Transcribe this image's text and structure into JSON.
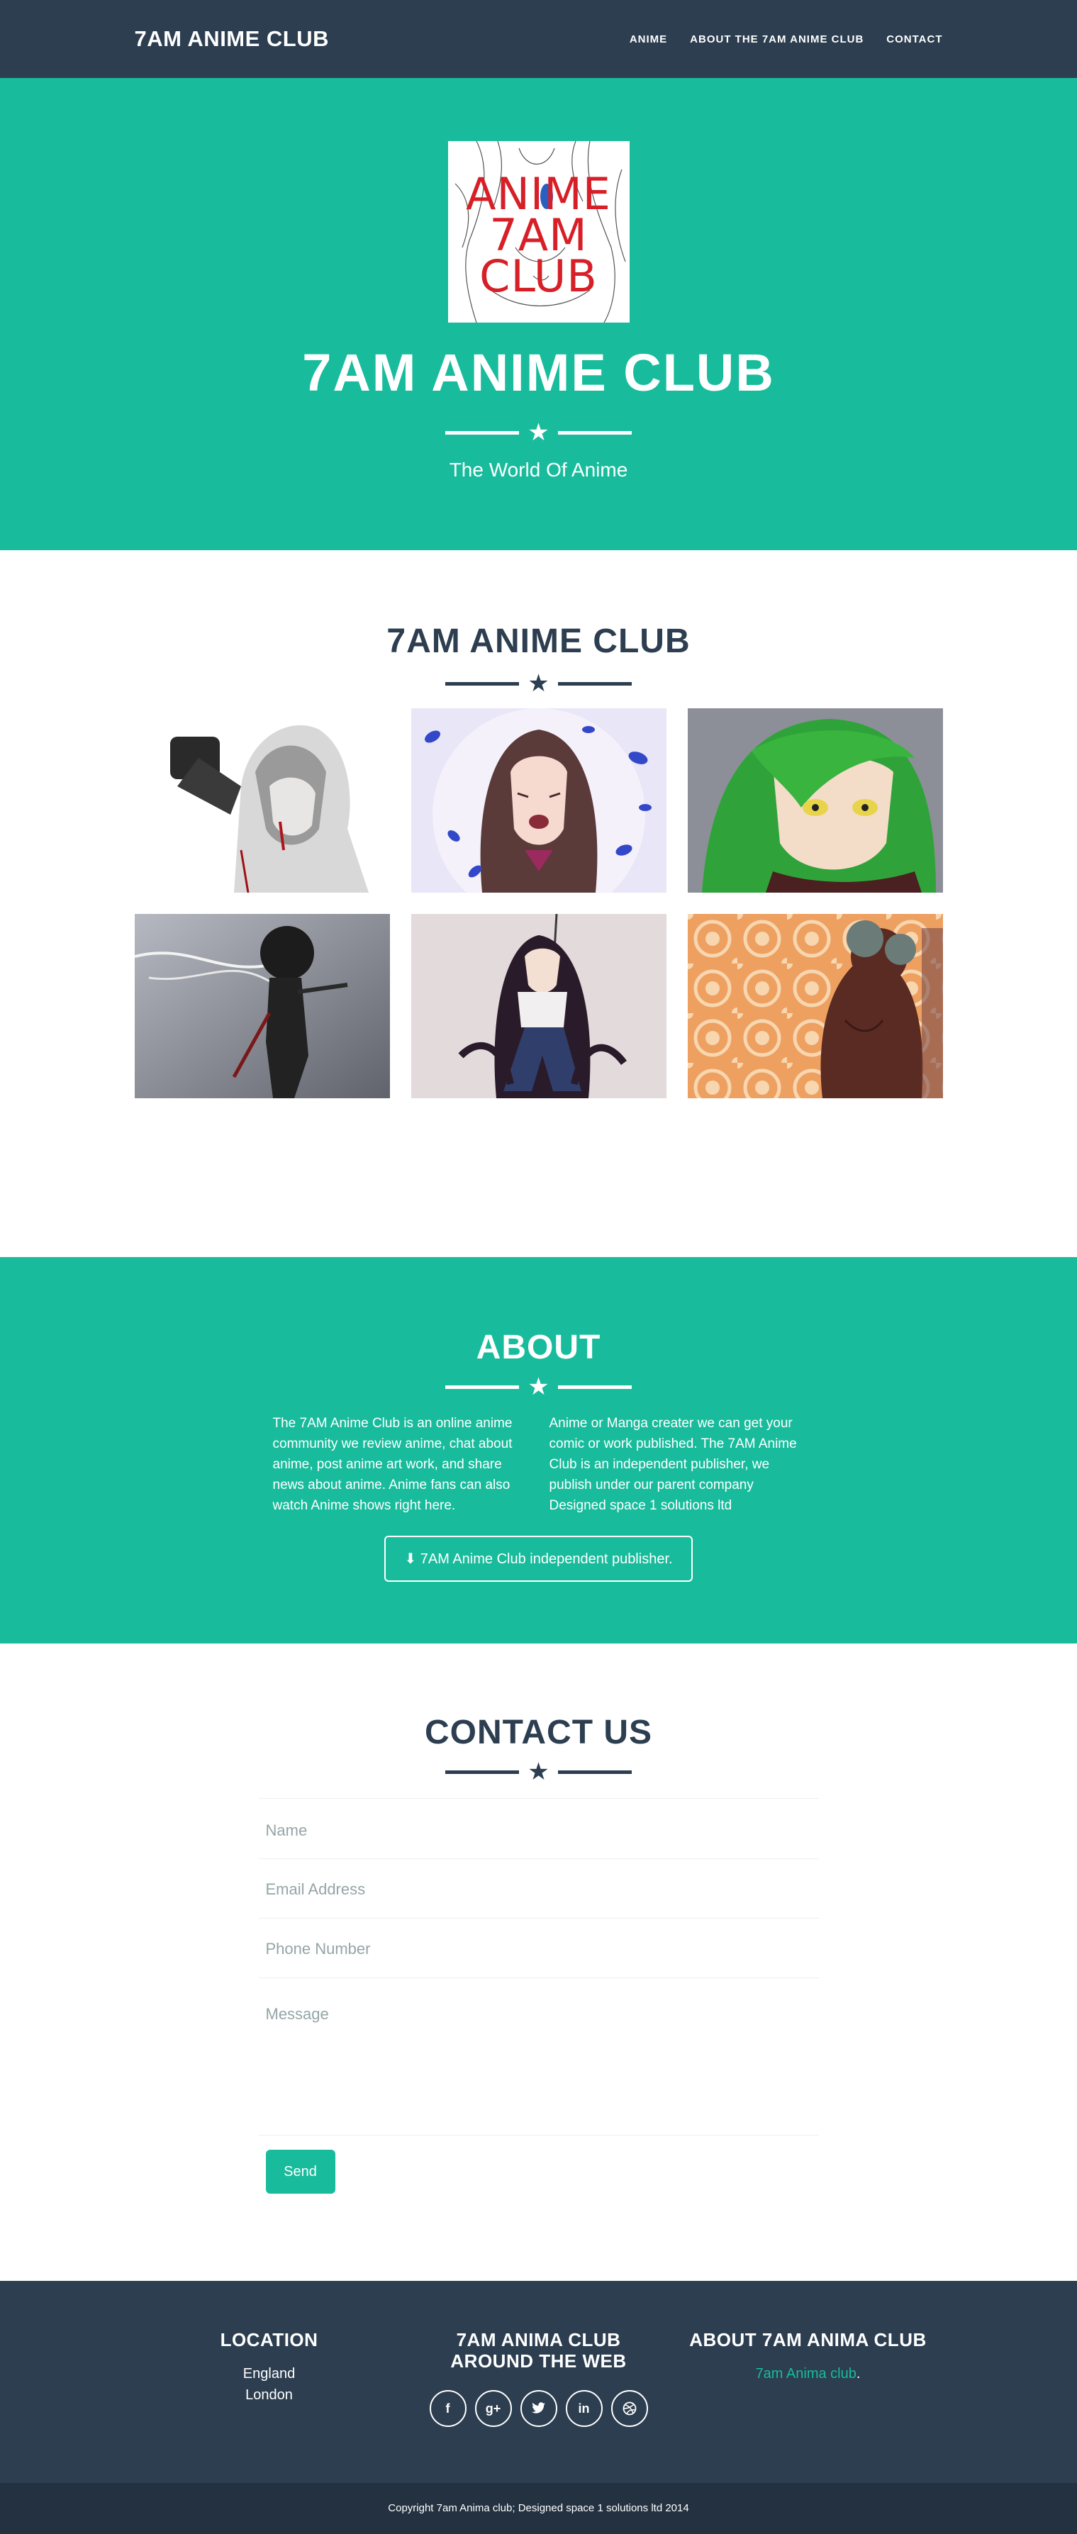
{
  "nav": {
    "brand": "7AM ANIME CLUB",
    "links": [
      "ANIME",
      "ABOUT THE 7AM ANIME CLUB",
      "CONTACT"
    ]
  },
  "hero": {
    "logo_text": [
      "ANIME",
      "7AM",
      "CLUB"
    ],
    "title": "7AM ANIME CLUB",
    "subtitle": "The World Of Anime"
  },
  "portfolio": {
    "title": "7AM ANIME CLUB",
    "tiles": [
      "hooded figure with gun",
      "crying girl with blue petals",
      "green-haired character",
      "figure with swords silhouette",
      "long-haired swordswoman",
      "character on floral background"
    ]
  },
  "about": {
    "title": "ABOUT",
    "left_text": "The 7AM Anime Club is an online anime community we review anime, chat about anime, post anime art work, and share news about anime. Anime fans can also watch Anime shows right here.",
    "right_text": "Anime or Manga creater we can get your comic or work published. The 7AM Anime Club is an independent publisher, we publish under our parent company Designed space 1 solutions ltd",
    "button_label": "7AM Anime Club independent publisher."
  },
  "contact": {
    "title": "CONTACT US",
    "name_placeholder": "Name",
    "email_placeholder": "Email Address",
    "phone_placeholder": "Phone Number",
    "message_placeholder": "Message",
    "send_label": "Send"
  },
  "footer": {
    "location_title": "LOCATION",
    "location_line1": "England",
    "location_line2": "London",
    "web_title_line1": "7AM ANIMA CLUB",
    "web_title_line2": "AROUND THE WEB",
    "social_icons": [
      "facebook-icon",
      "google-plus-icon",
      "twitter-icon",
      "linkedin-icon",
      "dribbble-icon"
    ],
    "about_title": "ABOUT 7AM ANIMA CLUB",
    "about_link": "7am Anima club",
    "about_suffix": ".",
    "copyright": "Copyright 7am Anima club; Designed space 1 solutions ltd 2014"
  },
  "colors": {
    "primary": "#2c3e50",
    "accent": "#18bc9c",
    "logo_red": "#d71f27"
  }
}
